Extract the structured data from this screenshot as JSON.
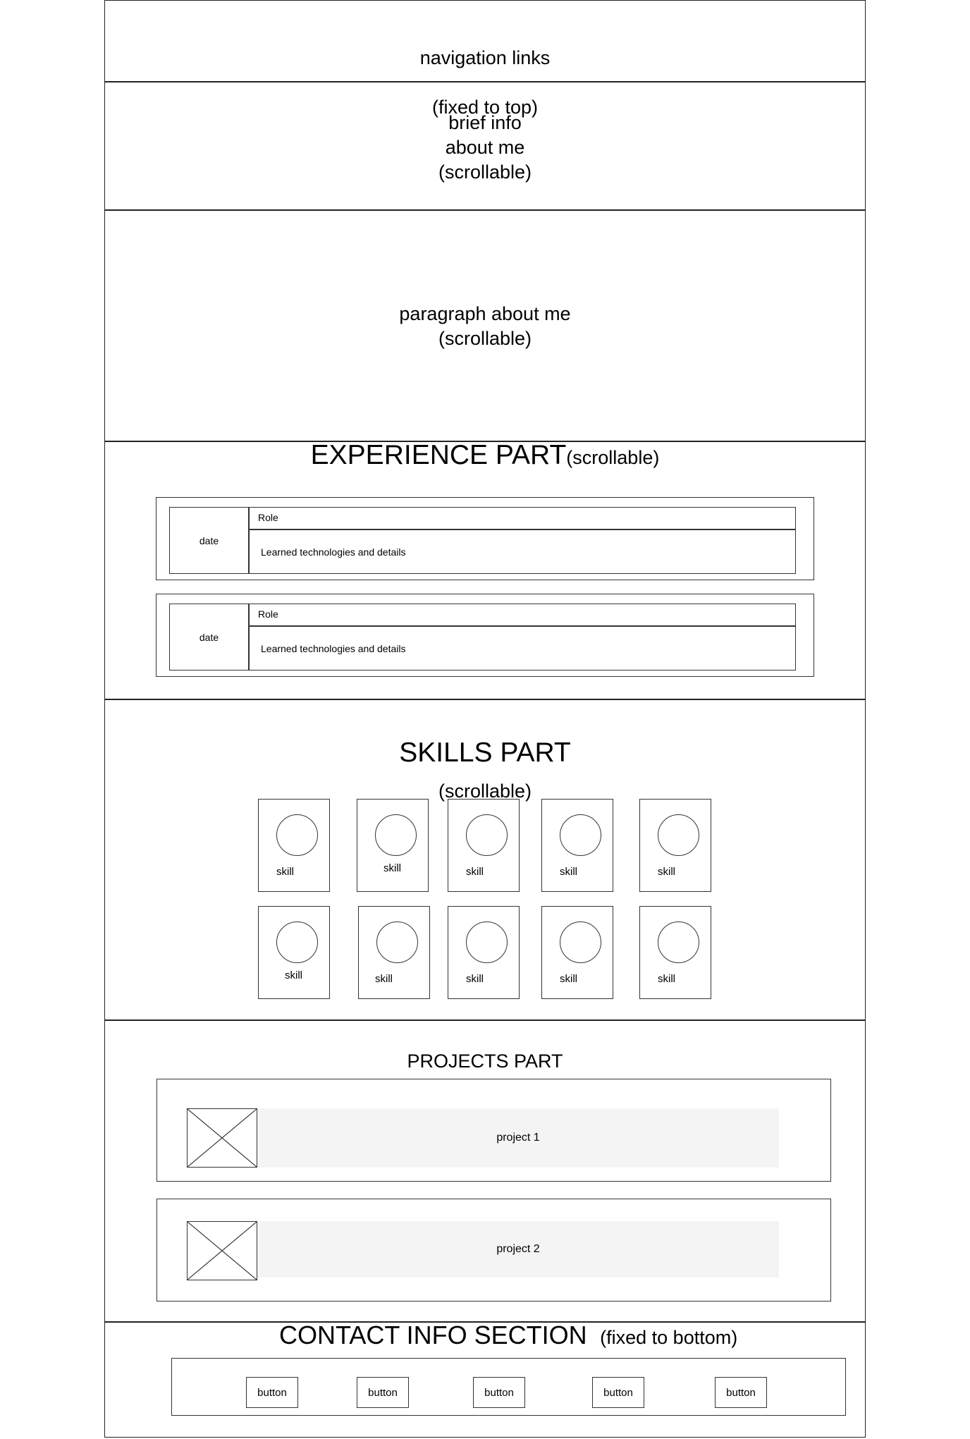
{
  "nav": {
    "title": "navigation links",
    "note": "(fixed to top)"
  },
  "brief": {
    "text": "brief info\nabout me\n(scrollable)"
  },
  "paragraph": {
    "text": "paragraph about me\n(scrollable)"
  },
  "experience": {
    "title": "EXPERIENCE PART",
    "note": "(scrollable)",
    "items": [
      {
        "date": "date",
        "role": "Role",
        "details": "Learned technologies and details"
      },
      {
        "date": "date",
        "role": "Role",
        "details": "Learned technologies and details"
      }
    ]
  },
  "skills": {
    "title": "SKILLS PART",
    "note": "(scrollable)",
    "items": [
      "skill",
      "skill",
      "skill",
      "skill",
      "skill",
      "skill",
      "skill",
      "skill",
      "skill",
      "skill"
    ]
  },
  "projects": {
    "title": "PROJECTS PART",
    "items": [
      {
        "label": "project 1"
      },
      {
        "label": "project 2"
      }
    ]
  },
  "contact": {
    "title": "CONTACT INFO SECTION",
    "note": "(fixed to bottom)",
    "buttons": [
      "button",
      "button",
      "button",
      "button",
      "button"
    ]
  }
}
